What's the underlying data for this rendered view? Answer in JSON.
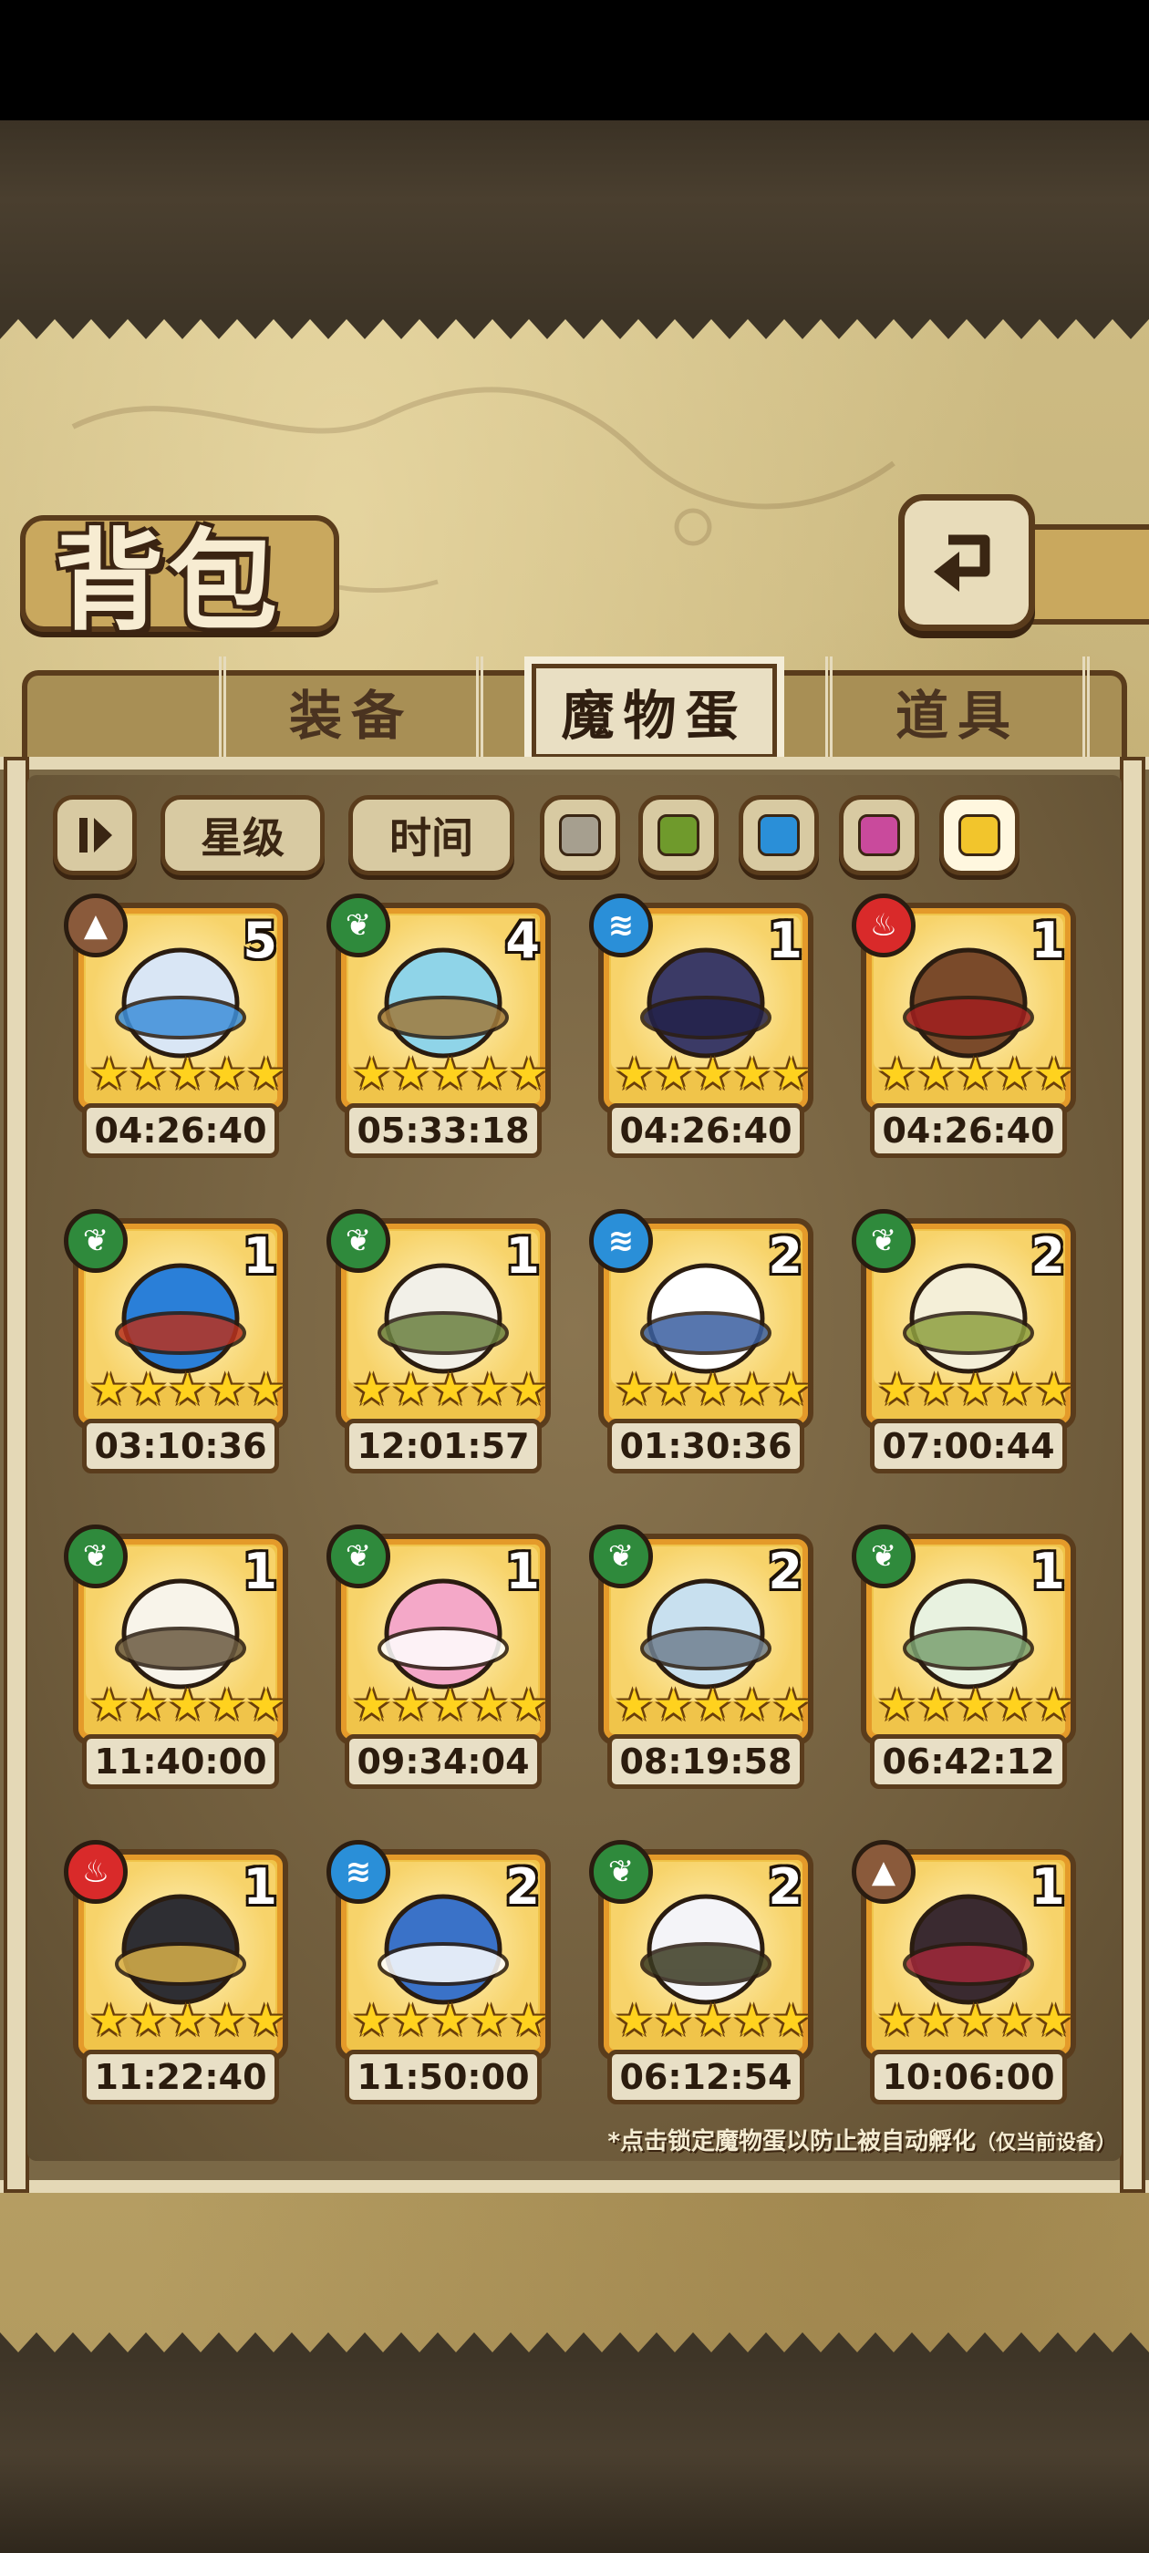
{
  "title": "背包",
  "tabs": [
    {
      "label": "装备"
    },
    {
      "label": "魔物蛋"
    },
    {
      "label": "道具"
    }
  ],
  "filters": {
    "sort_icon": "sort-toggle-icon",
    "star_label": "星级",
    "time_label": "时间",
    "colors": [
      "#a69f8f",
      "#6f9a2c",
      "#2a8fd8",
      "#c94a9c",
      "#f2c52c"
    ]
  },
  "eggs": [
    {
      "element": "earth",
      "count": "5",
      "timer": "04:26:40",
      "stars": "★★★★★",
      "art": "blue-bunny-egg"
    },
    {
      "element": "grass",
      "count": "4",
      "timer": "05:33:18",
      "stars": "★★★★★",
      "art": "mirror-egg"
    },
    {
      "element": "water",
      "count": "1",
      "timer": "04:26:40",
      "stars": "★★★★★",
      "art": "dark-feather-egg"
    },
    {
      "element": "fire",
      "count": "1",
      "timer": "04:26:40",
      "stars": "★★★★★",
      "art": "crossbow-egg"
    },
    {
      "element": "grass",
      "count": "1",
      "timer": "03:10:36",
      "stars": "★★★★★",
      "art": "fire-cat-egg"
    },
    {
      "element": "grass",
      "count": "1",
      "timer": "12:01:57",
      "stars": "★★★★★",
      "art": "laurel-egg"
    },
    {
      "element": "water",
      "count": "2",
      "timer": "01:30:36",
      "stars": "★★★★★",
      "art": "bird-egg"
    },
    {
      "element": "grass",
      "count": "2",
      "timer": "07:00:44",
      "stars": "★★★★★",
      "art": "leaf-egg"
    },
    {
      "element": "grass",
      "count": "1",
      "timer": "11:40:00",
      "stars": "★★★★★",
      "art": "winged-egg"
    },
    {
      "element": "grass",
      "count": "1",
      "timer": "09:34:04",
      "stars": "★★★★★",
      "art": "pink-pig-egg"
    },
    {
      "element": "grass",
      "count": "2",
      "timer": "08:19:58",
      "stars": "★★★★★",
      "art": "pocket-watch-egg"
    },
    {
      "element": "grass",
      "count": "1",
      "timer": "06:42:12",
      "stars": "★★★★★",
      "art": "flower-bulb-egg"
    },
    {
      "element": "fire",
      "count": "1",
      "timer": "11:22:40",
      "stars": "★★★★★",
      "art": "pirate-hat-egg"
    },
    {
      "element": "water",
      "count": "2",
      "timer": "11:50:00",
      "stars": "★★★★★",
      "art": "shark-egg"
    },
    {
      "element": "grass",
      "count": "2",
      "timer": "06:12:54",
      "stars": "★★★★★",
      "art": "wing-egg"
    },
    {
      "element": "earth",
      "count": "1",
      "timer": "10:06:00",
      "stars": "★★★★★",
      "art": "coffin-egg"
    }
  ],
  "hint": "*点击锁定魔物蛋以防止被自动孵化",
  "hint_note": "（仅当前设备）"
}
